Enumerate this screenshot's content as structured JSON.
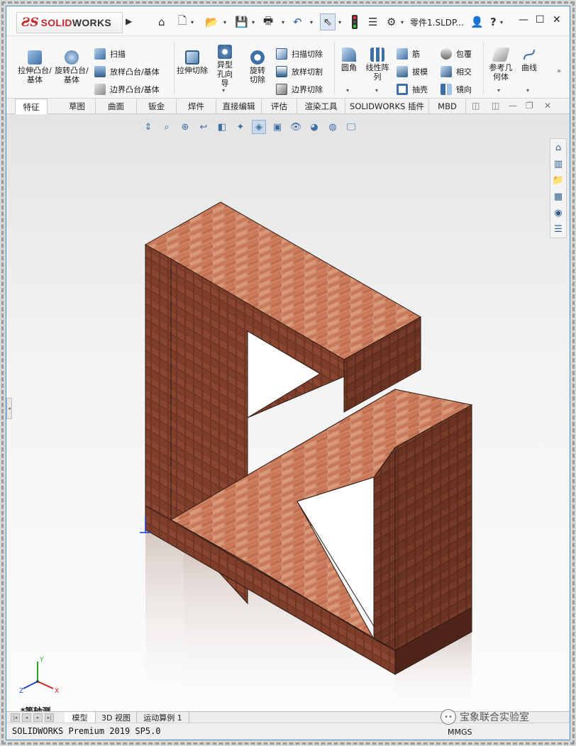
{
  "app": {
    "brand_prefix": "3DS",
    "brand_solid": "SOLID",
    "brand_works": "WORKS",
    "document_name": "零件1.SLDP...",
    "help": "?"
  },
  "ribbon": {
    "extrude_boss": "拉伸凸台/基体",
    "revolve_boss": "旋转凸台/基体",
    "sweep": "扫描",
    "loft": "放样凸台/基体",
    "boundary_boss": "边界凸台/基体",
    "extrude_cut": "拉伸切除",
    "hole_wizard": "异型孔向导",
    "revolve_cut": "旋转切除",
    "swept_cut": "扫描切除",
    "lofted_cut": "放样切割",
    "boundary_cut": "边界切除",
    "fillet": "圆角",
    "linear_pattern": "线性阵列",
    "rib": "筋",
    "draft": "拔模",
    "shell": "抽壳",
    "wrap": "包覆",
    "intersect": "相交",
    "mirror": "镜向",
    "ref_geometry": "参考几何体",
    "curves": "曲线"
  },
  "tabs": [
    "特征",
    "草图",
    "曲面",
    "钣金",
    "焊件",
    "直接编辑",
    "评估",
    "渲染工具",
    "SOLIDWORKS 插件",
    "MBD"
  ],
  "viewport": {
    "view_orientation": "*等轴测",
    "axes": {
      "x": "X",
      "y": "Y",
      "z": "Z"
    }
  },
  "bottom_tabs": [
    "模型",
    "3D 视图",
    "运动算例 1"
  ],
  "status": {
    "version": "SOLIDWORKS Premium 2019 SP5.0",
    "units": "MMGS"
  },
  "watermark": "宝象联合实验室",
  "colors": {
    "brand_red": "#c0282d",
    "brick_top": "#c9795a",
    "brick_side": "#7a3b27",
    "frame_border": "#4a8cc9"
  }
}
